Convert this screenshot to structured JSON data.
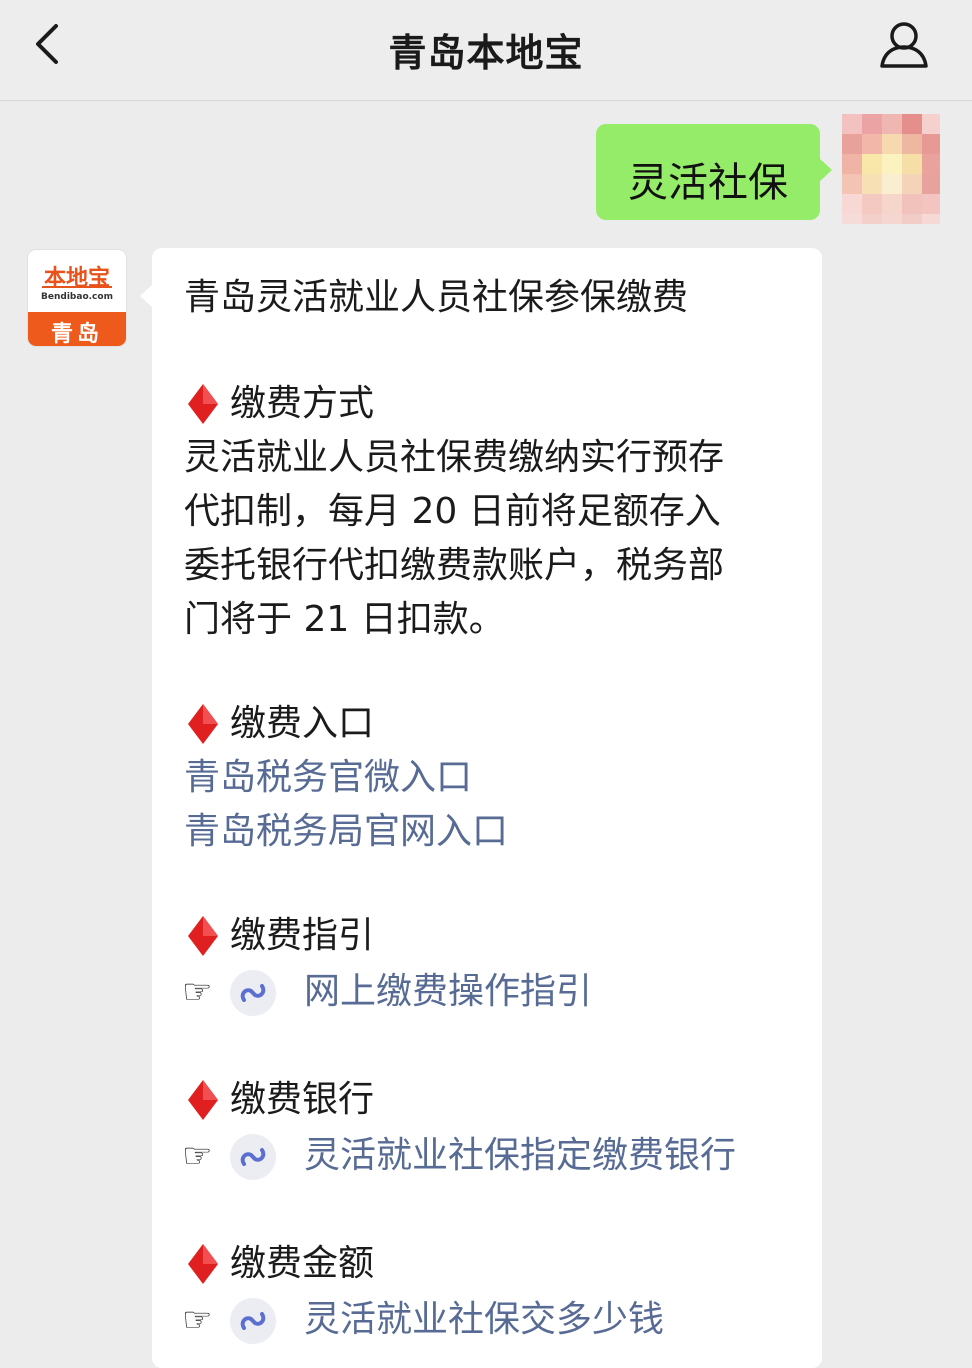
{
  "header": {
    "title": "青岛本地宝",
    "back_icon": "chevron-left-icon",
    "profile_icon": "person-icon"
  },
  "user_message": {
    "text": "灵活社保",
    "bubble_color": "#95ec69"
  },
  "bot": {
    "avatar": {
      "brand": "本地宝",
      "domain": "Bendibao.com",
      "city": "青岛",
      "color": "#ee5a1c"
    },
    "message": {
      "title": "青岛灵活就业人员社保参保缴费",
      "sections": [
        {
          "heading": "缴费方式",
          "body_lines": [
            "灵活就业人员社保费缴纳实行预存",
            "代扣制，每月 20 日前将足额存入",
            "委托银行代扣缴费款账户，税务部",
            "门将于 21 日扣款。"
          ]
        },
        {
          "heading": "缴费入口",
          "links": [
            "青岛税务官微入口",
            "青岛税务局官网入口"
          ]
        },
        {
          "heading": "缴费指引",
          "mini_link": "网上缴费操作指引"
        },
        {
          "heading": "缴费银行",
          "mini_link": "灵活就业社保指定缴费银行"
        },
        {
          "heading": "缴费金额",
          "mini_link": "灵活就业社保交多少钱"
        }
      ],
      "bullet_icon": "red-diamond-icon",
      "pointer_glyph": "☞",
      "link_color": "#576b95"
    }
  }
}
